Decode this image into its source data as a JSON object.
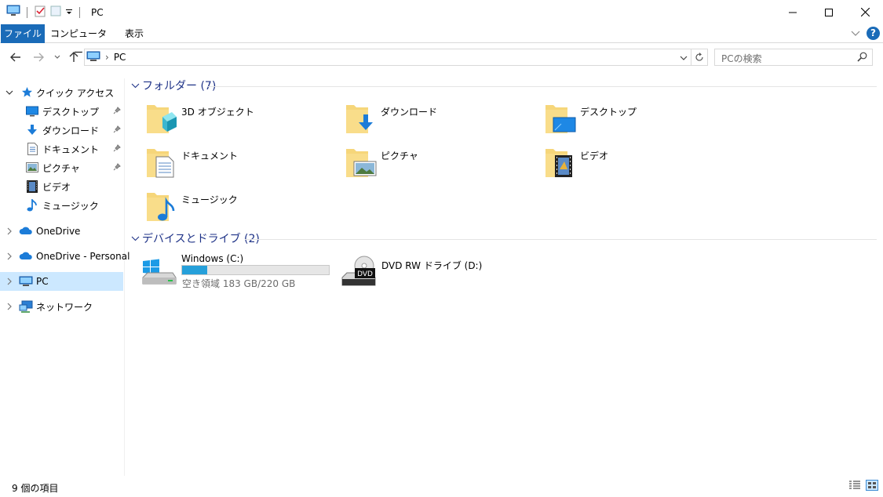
{
  "window": {
    "title": "PC"
  },
  "ribbon": {
    "tabs": [
      {
        "label": "ファイル",
        "active": true
      },
      {
        "label": "コンピューター"
      },
      {
        "label": "表示"
      }
    ],
    "help_label": "?"
  },
  "address": {
    "path": "PC",
    "separator": "›"
  },
  "search": {
    "placeholder": "PCの検索"
  },
  "sidebar": {
    "quick_access": {
      "label": "クイック アクセス",
      "items": [
        {
          "label": "デスクトップ",
          "icon": "desktop-icon",
          "pinned": true
        },
        {
          "label": "ダウンロード",
          "icon": "download-icon",
          "pinned": true
        },
        {
          "label": "ドキュメント",
          "icon": "document-icon",
          "pinned": true
        },
        {
          "label": "ピクチャ",
          "icon": "pictures-icon",
          "pinned": true
        },
        {
          "label": "ビデオ",
          "icon": "video-icon",
          "pinned": false
        },
        {
          "label": "ミュージック",
          "icon": "music-icon",
          "pinned": false
        }
      ]
    },
    "roots": [
      {
        "label": "OneDrive",
        "icon": "onedrive-icon"
      },
      {
        "label": "OneDrive - Personal",
        "icon": "onedrive-icon"
      },
      {
        "label": "PC",
        "icon": "pc-icon",
        "selected": true
      },
      {
        "label": "ネットワーク",
        "icon": "network-icon"
      }
    ]
  },
  "folders": {
    "header": "フォルダー (7)",
    "items": [
      {
        "label": "3D オブジェクト",
        "icon": "3d-objects-folder-icon"
      },
      {
        "label": "ダウンロード",
        "icon": "downloads-folder-icon"
      },
      {
        "label": "デスクトップ",
        "icon": "desktop-folder-icon"
      },
      {
        "label": "ドキュメント",
        "icon": "documents-folder-icon"
      },
      {
        "label": "ピクチャ",
        "icon": "pictures-folder-icon"
      },
      {
        "label": "ビデオ",
        "icon": "videos-folder-icon"
      },
      {
        "label": "ミュージック",
        "icon": "music-folder-icon"
      }
    ]
  },
  "drives": {
    "header": "デバイスとドライブ (2)",
    "items": [
      {
        "label": "Windows (C:)",
        "icon": "windows-drive-icon",
        "free_text": "空き領域 183 GB/220 GB",
        "used_fraction": 0.17
      },
      {
        "label": "DVD RW ドライブ (D:)",
        "icon": "dvd-drive-icon",
        "badge": "DVD"
      }
    ]
  },
  "status": {
    "item_count": "9 個の項目"
  },
  "colors": {
    "accent": "#1a6bb8",
    "selection": "#cce8ff",
    "group_header": "#1e3287",
    "drive_fill": "#26a0da"
  }
}
